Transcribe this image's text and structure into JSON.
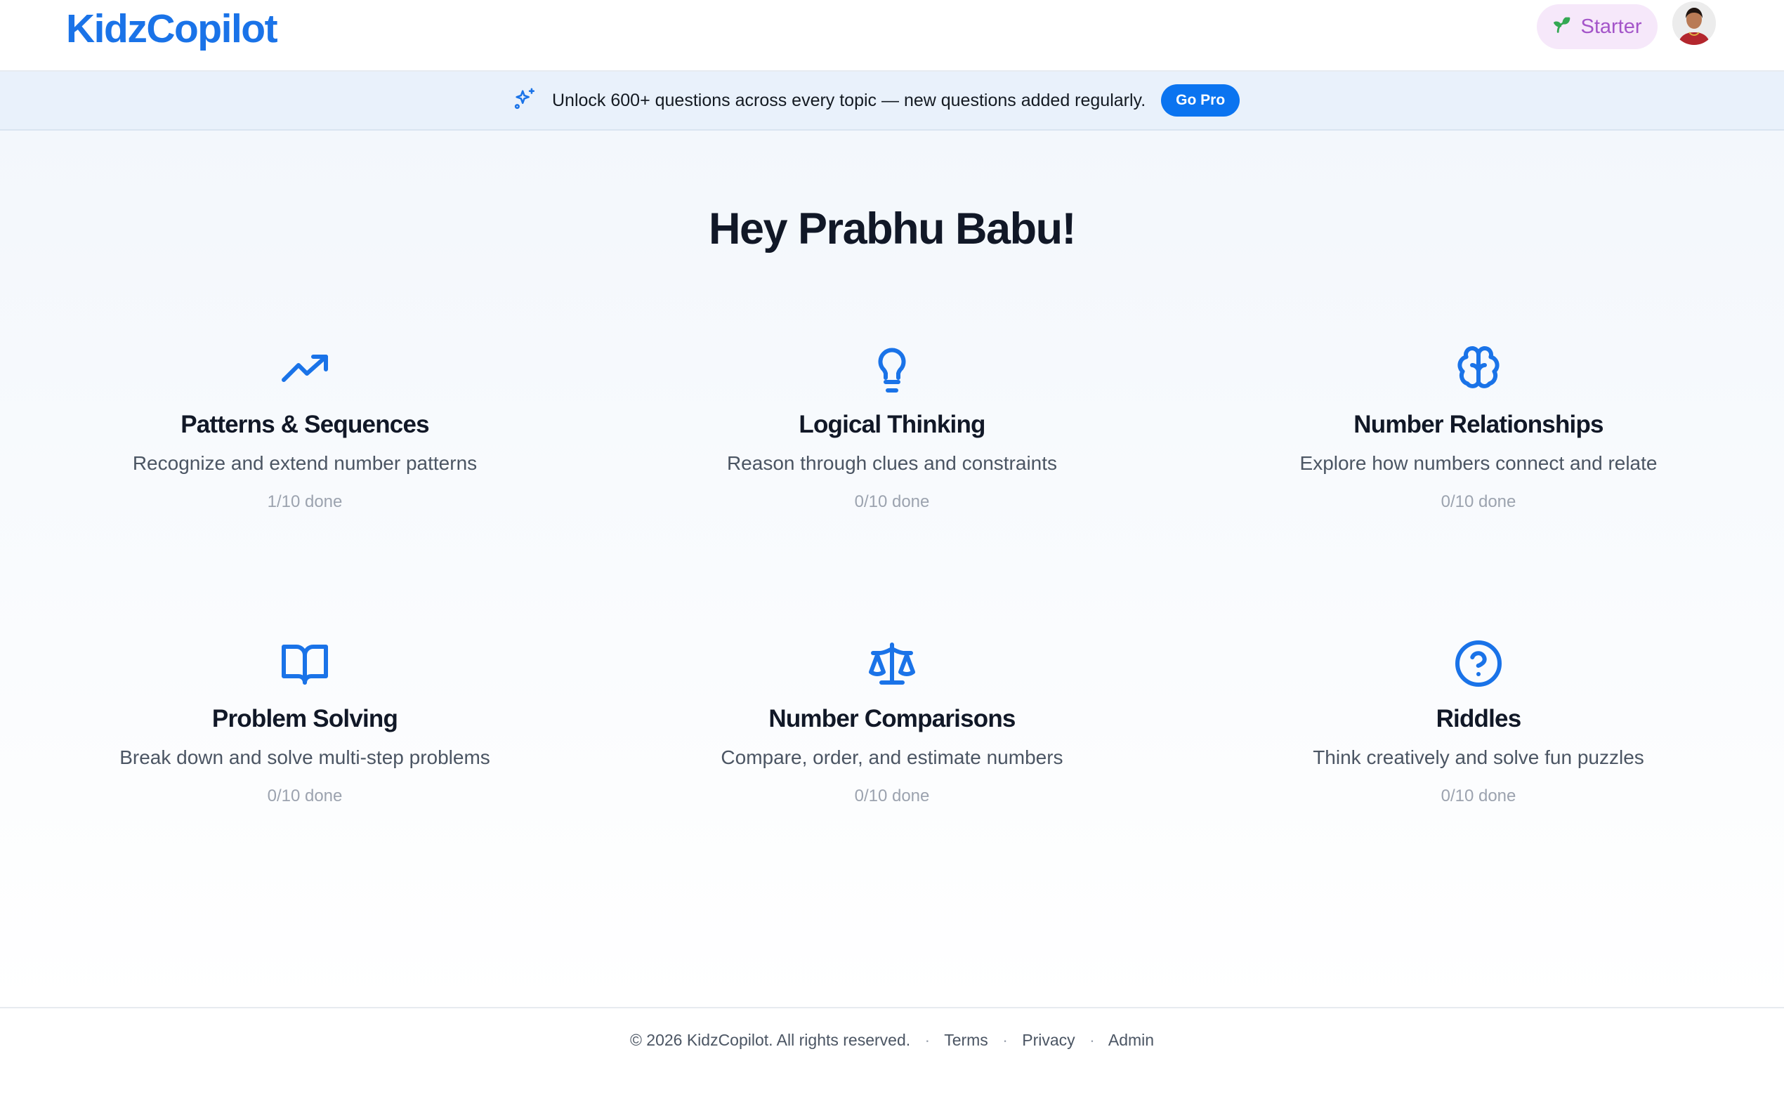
{
  "header": {
    "logo": "KidzCopilot",
    "plan_label": "Starter",
    "plan_icon": "sprout-icon"
  },
  "banner": {
    "icon": "sparkles-icon",
    "text": "Unlock 600+ questions across every topic — new questions added regularly.",
    "cta_label": "Go Pro"
  },
  "main": {
    "greeting": "Hey Prabhu Babu!",
    "topics": [
      {
        "icon": "trending-up-icon",
        "title": "Patterns & Sequences",
        "description": "Recognize and extend number patterns",
        "progress": "1/10 done"
      },
      {
        "icon": "lightbulb-icon",
        "title": "Logical Thinking",
        "description": "Reason through clues and constraints",
        "progress": "0/10 done"
      },
      {
        "icon": "brain-icon",
        "title": "Number Relationships",
        "description": "Explore how numbers connect and relate",
        "progress": "0/10 done"
      },
      {
        "icon": "book-open-icon",
        "title": "Problem Solving",
        "description": "Break down and solve multi-step problems",
        "progress": "0/10 done"
      },
      {
        "icon": "scale-icon",
        "title": "Number Comparisons",
        "description": "Compare, order, and estimate numbers",
        "progress": "0/10 done"
      },
      {
        "icon": "help-circle-icon",
        "title": "Riddles",
        "description": "Think creatively and solve fun puzzles",
        "progress": "0/10 done"
      }
    ]
  },
  "footer": {
    "copyright": "© 2026 KidzCopilot. All rights reserved.",
    "separator": "·",
    "links": [
      "Terms",
      "Privacy",
      "Admin"
    ]
  },
  "colors": {
    "accent": "#1a73e8",
    "cta": "#0b74f0",
    "plan_pill_bg": "#f6e8fa",
    "plan_pill_text": "#a455c9",
    "banner_bg": "#e9f1fb"
  }
}
